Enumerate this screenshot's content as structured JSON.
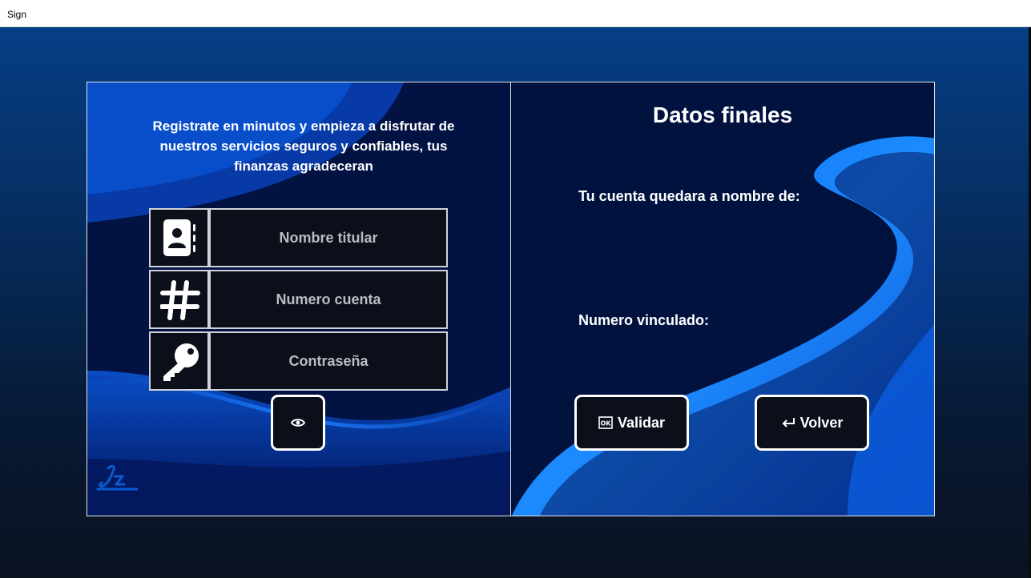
{
  "window": {
    "title": "Sign"
  },
  "left_panel": {
    "intro_text": "Registrate en minutos y empieza a disfrutar de nuestros servicios seguros y confiables, tus finanzas agradeceran",
    "fields": [
      {
        "icon": "contact-book-icon",
        "placeholder": "Nombre titular",
        "value": ""
      },
      {
        "icon": "hash-icon",
        "placeholder": "Numero cuenta",
        "value": ""
      },
      {
        "icon": "key-icon",
        "placeholder": "Contraseña",
        "value": ""
      }
    ],
    "show_password_icon": "eye-icon",
    "logo_icon": "signature-logo"
  },
  "right_panel": {
    "heading": "Datos finales",
    "name_label": "Tu cuenta quedara a nombre de:",
    "number_label": "Numero vinculado:",
    "validate_button": {
      "label": "Validar",
      "icon": "ok-icon"
    },
    "back_button": {
      "label": "Volver",
      "icon": "return-arrow-icon"
    }
  },
  "colors": {
    "panel_dark": "#021040",
    "wave_blue": "#0b6ff0",
    "button_bg": "#0b0f1a",
    "text": "#ffffff"
  }
}
